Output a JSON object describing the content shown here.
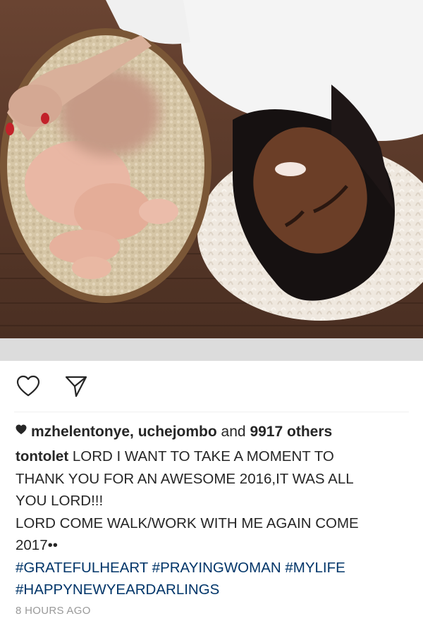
{
  "post": {
    "image": {
      "content": "photo-mother-and-newborn",
      "colors": {
        "wood": "#5b3b2b",
        "basket": "#d9c9ab",
        "fur": "#f1ebe3",
        "shirt": "#f4f4f4",
        "hair": "#161111",
        "skin": "#6b3e27"
      }
    },
    "actions": {
      "like_icon": "heart-outline-icon",
      "share_icon": "send-icon"
    },
    "likes": {
      "icon": "heart-filled-icon",
      "users": "mzhelentonye, uchejombo",
      "connector": "and",
      "others_count": "9917",
      "others_label": "others"
    },
    "caption": {
      "username": "tontolet",
      "line1": "LORD I WANT TO TAKE A MOMENT TO",
      "line2": "THANK YOU FOR AN AWESOME 2016,IT WAS ALL",
      "line3": "YOU LORD!!!",
      "line4": "LORD COME WALK/WORK WITH ME AGAIN COME",
      "line5": "2017••",
      "hashtags": [
        "#GRATEFULHEART",
        "#PRAYINGWOMAN",
        "#MYLIFE",
        "#HAPPYNEWYEARDARLINGS"
      ]
    },
    "timestamp": "8 HOURS AGO"
  },
  "theme": {
    "text": "#262626",
    "hashtag": "#003569",
    "muted": "#999999"
  }
}
